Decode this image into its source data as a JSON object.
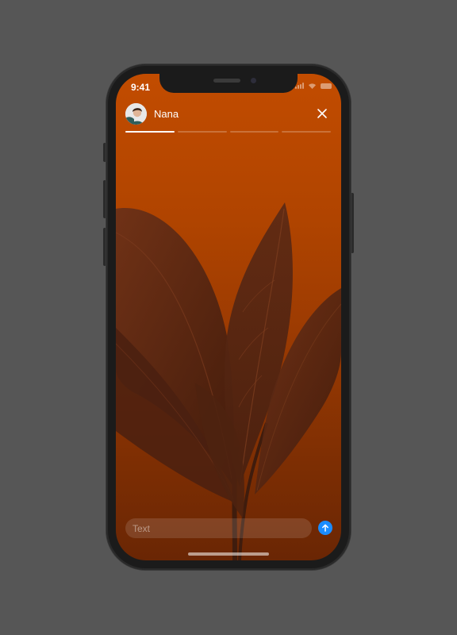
{
  "status_bar": {
    "time": "9:41",
    "signal_icon": "cellular-signal-icon",
    "wifi_icon": "wifi-icon",
    "battery_icon": "battery-icon"
  },
  "story": {
    "user_name": "Nana",
    "avatar_icon": "user-avatar",
    "close_icon": "close-icon",
    "segments_total": 4,
    "active_segment": 1,
    "active_segment_progress": 1.0
  },
  "reply": {
    "placeholder": "Text",
    "value": "",
    "send_icon": "arrow-up-icon"
  },
  "colors": {
    "frame_background": "#565656",
    "story_gradient_top": "#c24c00",
    "story_gradient_bottom": "#6a2604",
    "send_button": "#1a8cff",
    "text": "#ffffff"
  }
}
